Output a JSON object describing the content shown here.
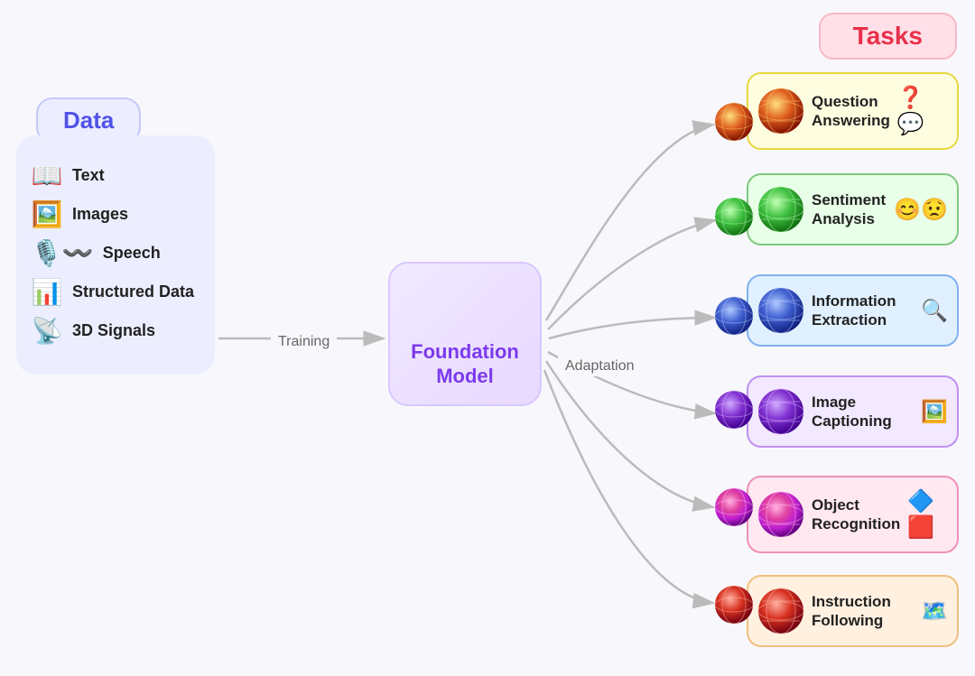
{
  "page": {
    "background": "#f8f8fc"
  },
  "data_section": {
    "title": "Data",
    "items": [
      {
        "id": "text",
        "label": "Text",
        "icon": "📖"
      },
      {
        "id": "images",
        "label": "Images",
        "icon": "🖼️"
      },
      {
        "id": "speech",
        "label": "Speech",
        "icon": "🎙️"
      },
      {
        "id": "structured",
        "label": "Structured Data",
        "icon": "📊"
      },
      {
        "id": "signals",
        "label": "3D Signals",
        "icon": "📡"
      }
    ]
  },
  "foundation_model": {
    "label_line1": "Foundation",
    "label_line2": "Model"
  },
  "labels": {
    "training": "Training",
    "adaptation": "Adaptation",
    "tasks": "Tasks"
  },
  "tasks": [
    {
      "id": "qa",
      "label": "Question\nAnswering",
      "bg": "#fffde0",
      "border": "#f0e060",
      "icon_right": "❓💬",
      "color": "#b8920a"
    },
    {
      "id": "sentiment",
      "label": "Sentiment\nAnalysis",
      "bg": "#e8ffe8",
      "border": "#90d890",
      "icon_right": "😊😟",
      "color": "#2a8a2a"
    },
    {
      "id": "info-extraction",
      "label": "Information\nExtraction",
      "bg": "#e0f0ff",
      "border": "#80b8f0",
      "icon_right": "🔍",
      "color": "#1a5fa8"
    },
    {
      "id": "image-captioning",
      "label": "Image\nCaptioning",
      "bg": "#f0e8ff",
      "border": "#c090f0",
      "icon_right": "🖼️",
      "color": "#6a2aa8"
    },
    {
      "id": "object-recognition",
      "label": "Object\nRecognition",
      "bg": "#ffe8f0",
      "border": "#f090b8",
      "icon_right": "🔷🟥",
      "color": "#b82060"
    },
    {
      "id": "instruction-following",
      "label": "Instruction\nFollowing",
      "bg": "#fff0e0",
      "border": "#f0c080",
      "icon_right": "🗺️",
      "color": "#a85010"
    }
  ]
}
